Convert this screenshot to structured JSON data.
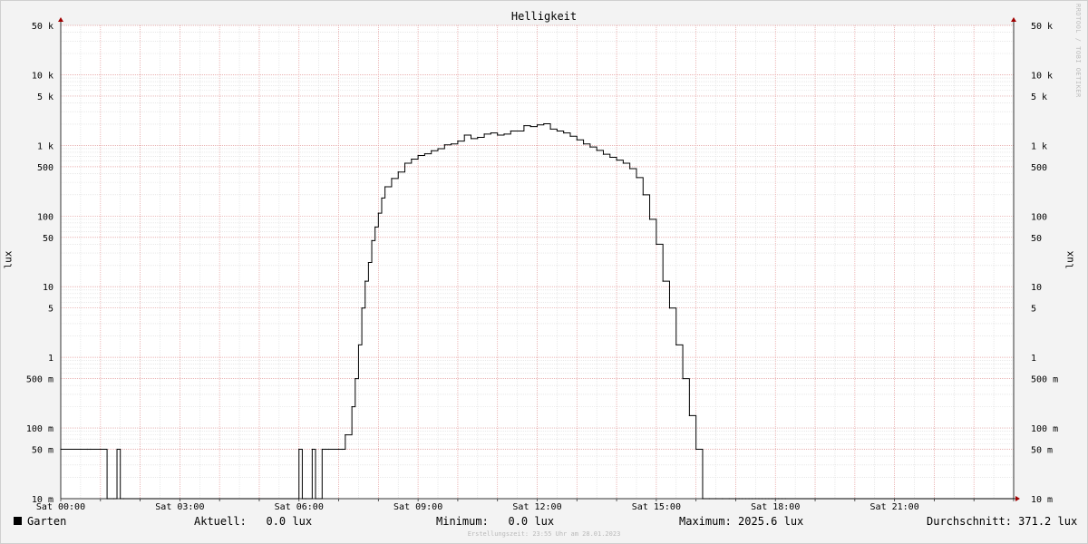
{
  "chart_data": {
    "type": "line",
    "title": "Helligkeit",
    "ylabel": "lux",
    "yscale": "log",
    "ylim": [
      0.01,
      50000
    ],
    "y_ticks": [
      {
        "value": 50000,
        "label": "50 k"
      },
      {
        "value": 10000,
        "label": "10 k"
      },
      {
        "value": 5000,
        "label": "5 k"
      },
      {
        "value": 1000,
        "label": "1 k"
      },
      {
        "value": 500,
        "label": "500"
      },
      {
        "value": 100,
        "label": "100"
      },
      {
        "value": 50,
        "label": "50"
      },
      {
        "value": 10,
        "label": "10"
      },
      {
        "value": 5,
        "label": "5"
      },
      {
        "value": 1,
        "label": "1"
      },
      {
        "value": 0.5,
        "label": "500 m"
      },
      {
        "value": 0.1,
        "label": "100 m"
      },
      {
        "value": 0.05,
        "label": "50 m"
      },
      {
        "value": 0.01,
        "label": "10 m"
      }
    ],
    "xlim": [
      "00:00",
      "24:00"
    ],
    "x_ticks": [
      {
        "value": "00:00",
        "label": "Sat 00:00"
      },
      {
        "value": "03:00",
        "label": "Sat 03:00"
      },
      {
        "value": "06:00",
        "label": "Sat 06:00"
      },
      {
        "value": "09:00",
        "label": "Sat 09:00"
      },
      {
        "value": "12:00",
        "label": "Sat 12:00"
      },
      {
        "value": "15:00",
        "label": "Sat 15:00"
      },
      {
        "value": "18:00",
        "label": "Sat 18:00"
      },
      {
        "value": "21:00",
        "label": "Sat 21:00"
      }
    ],
    "grid": true,
    "series": [
      {
        "name": "Garten",
        "color": "#000000",
        "x": [
          "00:00",
          "00:40",
          "00:45",
          "01:10",
          "01:20",
          "01:25",
          "01:30",
          "01:35",
          "06:00",
          "06:05",
          "06:10",
          "06:20",
          "06:25",
          "06:35",
          "06:40",
          "06:45",
          "07:05",
          "07:10",
          "07:20",
          "07:25",
          "07:30",
          "07:35",
          "07:40",
          "07:45",
          "07:50",
          "07:55",
          "08:00",
          "08:05",
          "08:10",
          "08:20",
          "08:30",
          "08:40",
          "08:50",
          "09:00",
          "09:10",
          "09:20",
          "09:30",
          "09:40",
          "09:50",
          "10:00",
          "10:10",
          "10:20",
          "10:30",
          "10:40",
          "10:50",
          "11:00",
          "11:10",
          "11:20",
          "11:30",
          "11:40",
          "11:50",
          "12:00",
          "12:10",
          "12:20",
          "12:30",
          "12:40",
          "12:50",
          "13:00",
          "13:10",
          "13:20",
          "13:30",
          "13:40",
          "13:50",
          "14:00",
          "14:10",
          "14:20",
          "14:30",
          "14:40",
          "14:50",
          "15:00",
          "15:10",
          "15:20",
          "15:30",
          "15:40",
          "15:50",
          "16:00",
          "16:10",
          "16:20",
          "16:30",
          "16:40",
          "16:50",
          "17:00",
          "17:05",
          "17:10",
          "17:15",
          "17:20",
          "17:25",
          "17:30",
          "17:35",
          "17:40",
          "17:45",
          "17:50",
          "17:55",
          "18:00",
          "18:05",
          "18:10",
          "18:15",
          "24:00"
        ],
        "values": [
          0.05,
          0.05,
          0.05,
          0.01,
          0.01,
          0.05,
          0.01,
          0.01,
          0.05,
          0.01,
          0.01,
          0.05,
          0.01,
          0.05,
          0.05,
          0.05,
          0.05,
          0.08,
          0.2,
          0.5,
          1.5,
          5,
          12,
          22,
          45,
          70,
          110,
          180,
          260,
          340,
          420,
          560,
          640,
          720,
          760,
          840,
          900,
          1020,
          1050,
          1150,
          1400,
          1250,
          1300,
          1450,
          1500,
          1400,
          1450,
          1600,
          1600,
          1900,
          1850,
          1950,
          2025,
          1700,
          1600,
          1500,
          1350,
          1200,
          1050,
          950,
          850,
          750,
          680,
          620,
          560,
          470,
          350,
          200,
          90,
          40,
          12,
          5,
          1.5,
          0.5,
          0.15,
          0.05,
          0.01,
          0.01,
          0.01,
          0.01,
          0.01,
          0.01,
          0.01,
          0.01,
          0.01,
          0.01,
          0.01,
          0.01,
          0.01,
          0.01,
          0.01,
          0.01,
          0.01,
          0.01,
          0.01,
          0.01,
          0.01,
          0.01
        ]
      }
    ]
  },
  "legend": {
    "series_name": "Garten",
    "aktuell": "Aktuell:   0.0 lux",
    "minimum": "Minimum:   0.0 lux",
    "maximum": "Maximum: 2025.6 lux",
    "durchschnitt": "Durchschnitt: 371.2 lux"
  },
  "watermark": "RRDTOOL / TOBI OETIKER",
  "footer": "Erstellungszeit: 23:55 Uhr am 28.01.2023"
}
